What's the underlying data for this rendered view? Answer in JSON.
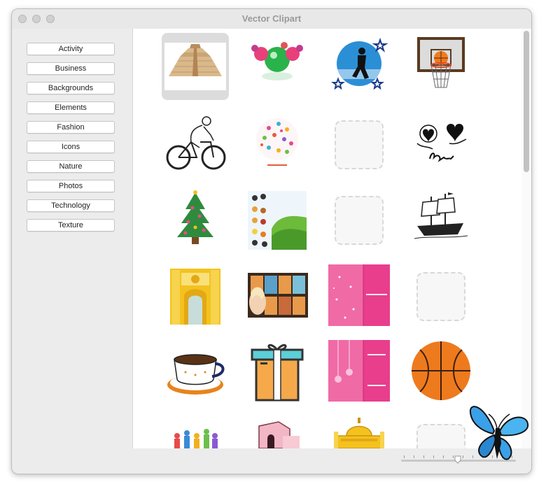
{
  "window": {
    "title": "Vector Clipart"
  },
  "sidebar": {
    "categories": [
      "Activity",
      "Business",
      "Backgrounds",
      "Elements",
      "Fashion",
      "Icons",
      "Nature",
      "Photos",
      "Technology",
      "Texture"
    ]
  },
  "grid": {
    "items": [
      {
        "icon": "pyramid-icon",
        "selected": true
      },
      {
        "icon": "christmas-ornaments-icon"
      },
      {
        "icon": "basketball-player-icon"
      },
      {
        "icon": "basketball-hoop-icon"
      },
      {
        "icon": "cyclist-icon"
      },
      {
        "icon": "christmas-wreath-icon"
      },
      {
        "icon": "loading-placeholder-icon"
      },
      {
        "icon": "love-hearts-icon"
      },
      {
        "icon": "christmas-tree-icon"
      },
      {
        "icon": "food-landscape-icon"
      },
      {
        "icon": "loading-placeholder-icon"
      },
      {
        "icon": "sailing-ship-icon"
      },
      {
        "icon": "palace-facade-icon"
      },
      {
        "icon": "women-portraits-icon"
      },
      {
        "icon": "birthday-card-icon"
      },
      {
        "icon": "loading-placeholder-icon"
      },
      {
        "icon": "coffee-cup-icon"
      },
      {
        "icon": "gift-box-icon"
      },
      {
        "icon": "christmas-card-icon"
      },
      {
        "icon": "basketball-icon"
      },
      {
        "icon": "people-crowd-icon"
      },
      {
        "icon": "pink-house-icon"
      },
      {
        "icon": "mosque-dome-icon"
      },
      {
        "icon": "loading-placeholder-icon"
      }
    ]
  },
  "accent_colors": {
    "selection": "#dcdcdc",
    "birthday_card": "#e83e8c",
    "butterfly": "#3aa0e8"
  }
}
